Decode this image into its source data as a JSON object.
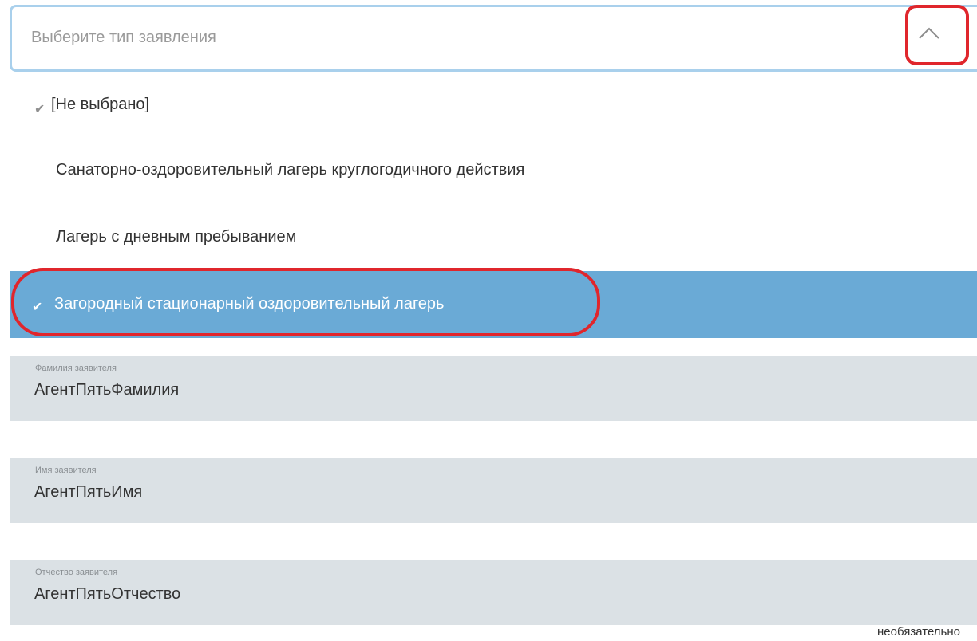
{
  "select": {
    "placeholder": "Выберите тип заявления",
    "expanded": true
  },
  "dropdown": {
    "options": [
      {
        "label": "[Не выбрано]",
        "checked": true,
        "selected": false
      },
      {
        "label": "Санаторно-оздоровительный лагерь круглогодичного действия",
        "checked": false,
        "selected": false
      },
      {
        "label": "Лагерь с дневным пребыванием",
        "checked": false,
        "selected": false
      },
      {
        "label": "Загородный стационарный оздоровительный лагерь",
        "checked": true,
        "selected": true
      }
    ]
  },
  "fields": [
    {
      "label": "Фамилия заявителя",
      "value": "АгентПятьФамилия"
    },
    {
      "label": "Имя заявителя",
      "value": "АгентПятьИмя"
    },
    {
      "label": "Отчество заявителя",
      "value": "АгентПятьОтчество"
    }
  ],
  "optional_note": "необязательно",
  "colors": {
    "accent_selected": "#6aaad6",
    "select_border": "#a9d0ec",
    "field_bg": "#dbe1e5",
    "annotation_red": "#e0262c"
  },
  "icons": {
    "chevron": "chevron-up-icon",
    "check": "check-icon"
  }
}
